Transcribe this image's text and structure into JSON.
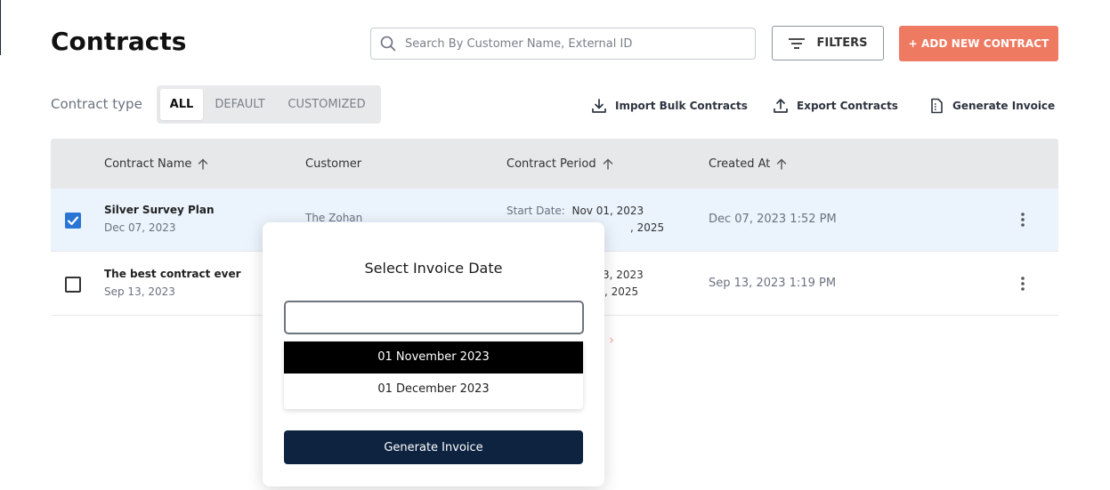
{
  "page": {
    "title": "Contracts"
  },
  "search": {
    "placeholder": "Search By Customer Name, External ID",
    "value": ""
  },
  "toolbar": {
    "filters_label": "FILTERS",
    "add_label": "+ ADD NEW CONTRACT",
    "add_color": "#ee7a62"
  },
  "contract_type": {
    "label": "Contract type",
    "options": [
      "ALL",
      "DEFAULT",
      "CUSTOMIZED"
    ],
    "selected": "ALL"
  },
  "actions": {
    "import": "Import Bulk Contracts",
    "export": "Export Contracts",
    "invoice": "Generate Invoice"
  },
  "table": {
    "columns": [
      "Contract Name",
      "Customer",
      "Contract Period",
      "Created At"
    ],
    "rows": [
      {
        "name": "Silver Survey Plan",
        "date": "Dec 07, 2023",
        "customer": "The Zohan",
        "start_label": "Start Date:",
        "start_date": "Nov 01, 2023",
        "end_partial": ", 2025",
        "created": "Dec 07, 2023 1:52 PM",
        "checked": true
      },
      {
        "name": "The best contract ever",
        "date": "Sep 13, 2023",
        "start_partial": "3, 2023",
        "end_partial": ", 2025",
        "created": "Sep 13, 2023 1:19 PM",
        "checked": false
      }
    ]
  },
  "invoice_modal": {
    "title": "Select Invoice Date",
    "input_value": "",
    "options": [
      "01 November 2023",
      "01 December 2023"
    ],
    "highlighted": "01 November 2023",
    "generate_label": "Generate Invoice",
    "button_color": "#0d2340"
  },
  "icons": {
    "search": "search-icon",
    "filters": "filter-lines-icon",
    "import": "download-icon",
    "export": "upload-icon",
    "invoice": "document-icon",
    "sort": "arrow-up-icon",
    "row_menu": "kebab-icon",
    "pager_next": "chevron-right-icon"
  }
}
